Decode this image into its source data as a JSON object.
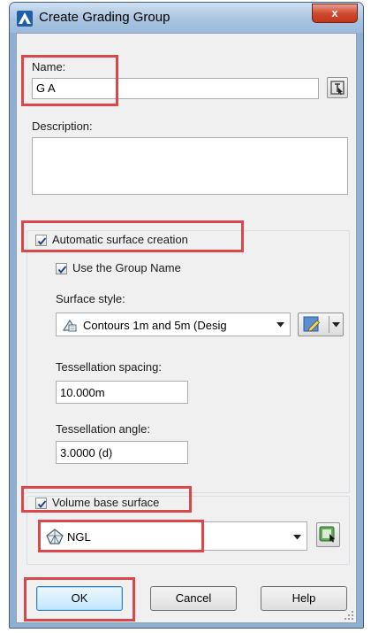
{
  "dialog": {
    "title": "Create Grading Group",
    "close_label": "x"
  },
  "name": {
    "label": "Name:",
    "value": "G A"
  },
  "description": {
    "label": "Description:",
    "value": ""
  },
  "automatic_surface": {
    "label": "Automatic surface creation",
    "checked": true,
    "use_group_name": {
      "label": "Use the Group Name",
      "checked": true
    },
    "surface_style": {
      "label": "Surface style:",
      "value": "Contours 1m and 5m (Desig"
    },
    "tessellation_spacing": {
      "label": "Tessellation spacing:",
      "value": "10.000m"
    },
    "tessellation_angle": {
      "label": "Tessellation angle:",
      "value": "3.0000 (d)"
    }
  },
  "volume_base": {
    "label": "Volume base surface",
    "checked": true,
    "surface": "NGL"
  },
  "buttons": {
    "ok": "OK",
    "cancel": "Cancel",
    "help": "Help"
  },
  "highlight_color": "#d9474b",
  "icons": {
    "app": "autocad-civil-logo-icon",
    "pick": "pick-from-drawing-icon",
    "style_edit": "edit-style-icon",
    "surface": "surface-icon",
    "select_surface": "select-surface-icon"
  }
}
